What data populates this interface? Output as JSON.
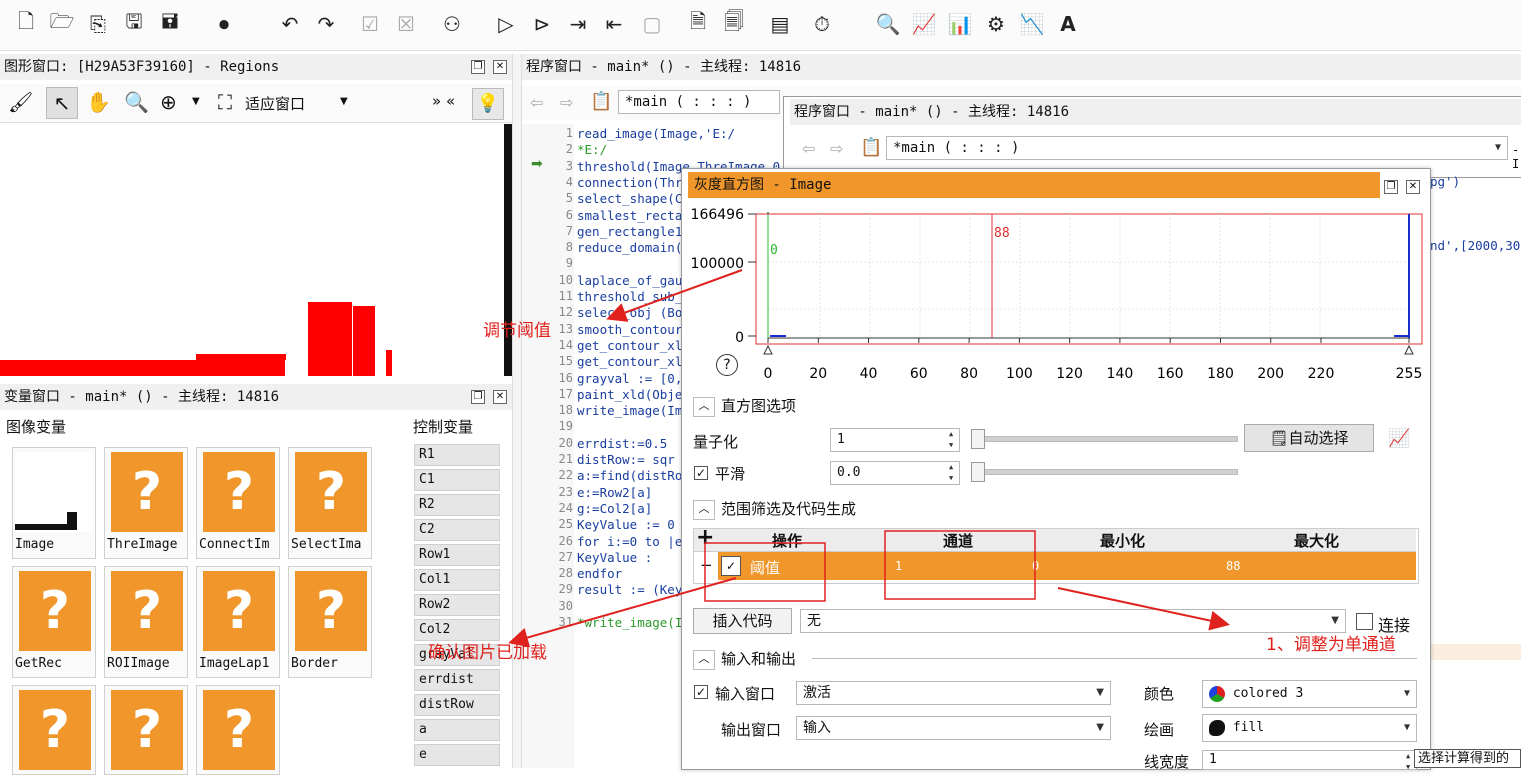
{
  "toolbar": {
    "icons": [
      "new-file-icon",
      "open-file-icon",
      "export-icon",
      "save-icon",
      "save-all-icon",
      "record-icon",
      "undo-icon",
      "redo-icon",
      "activate-icon",
      "deactivate-icon",
      "binoculars-icon",
      "run-icon",
      "step-icon",
      "step-over-icon",
      "step-back-icon",
      "stop-icon",
      "insert-code-icon",
      "program-icon",
      "profiler-icon",
      "timer-icon",
      "zoom-icon",
      "histogram-icon",
      "line-profile-icon",
      "gray-icon",
      "feature-icon",
      "ocr-icon"
    ]
  },
  "graphics_window": {
    "title": "图形窗口: [H29A53F39160] - Regions",
    "fit_label": "适应窗口",
    "arrows": "» «"
  },
  "variable_window": {
    "title": "变量窗口 - main* () - 主线程: 14816",
    "image_vars_title": "图像变量",
    "control_vars_title": "控制变量",
    "image_vars": [
      "Image",
      "ThreImage",
      "ConnectIm",
      "SelectIma",
      "GetRec",
      "ROIImage",
      "ImageLap1",
      "Border",
      "",
      "",
      ""
    ],
    "control_vars": [
      "R1",
      "C1",
      "R2",
      "C2",
      "Row1",
      "Col1",
      "Row2",
      "Col2",
      "grayVal",
      "errdist",
      "distRow",
      "a",
      "e"
    ]
  },
  "program_window_back": {
    "title": "程序窗口 - main* () - 主线程: 14816",
    "proc_label": "*main ( : : : )"
  },
  "program_window_front": {
    "title": "程序窗口 - main* () - 主线程: 14816",
    "proc_label": "*main ( : : : )",
    "side_text_1": "pg')",
    "side_text_2": "nd',[2000,30",
    "side_text_3": "-I"
  },
  "code": {
    "lines": [
      {
        "n": "1",
        "t": "read_image(Image,'E:/"
      },
      {
        "n": "2",
        "t": "*E:/"
      },
      {
        "n": "3",
        "t": "threshold(Image,ThreImage,0"
      },
      {
        "n": "4",
        "t": "connection(Thr"
      },
      {
        "n": "5",
        "t": "select_shape(C"
      },
      {
        "n": "6",
        "t": "smallest_recta"
      },
      {
        "n": "7",
        "t": "gen_rectangle1"
      },
      {
        "n": "8",
        "t": "reduce_domain("
      },
      {
        "n": "9",
        "t": ""
      },
      {
        "n": "10",
        "t": "laplace_of_gau"
      },
      {
        "n": "11",
        "t": "threshold_sub_"
      },
      {
        "n": "12",
        "t": "select_obj (Bo"
      },
      {
        "n": "13",
        "t": "smooth_contour"
      },
      {
        "n": "14",
        "t": "get_contour_xl"
      },
      {
        "n": "15",
        "t": "get_contour_xl"
      },
      {
        "n": "16",
        "t": "grayval := [0,"
      },
      {
        "n": "17",
        "t": "paint_xld(Obje"
      },
      {
        "n": "18",
        "t": "write_image(Im"
      },
      {
        "n": "19",
        "t": ""
      },
      {
        "n": "20",
        "t": "errdist:=0.5"
      },
      {
        "n": "21",
        "t": "distRow:=  sqr"
      },
      {
        "n": "22",
        "t": "a:=find(distRo"
      },
      {
        "n": "23",
        "t": "e:=Row2[a]"
      },
      {
        "n": "24",
        "t": "g:=Col2[a]"
      },
      {
        "n": "25",
        "t": "KeyValue := 0"
      },
      {
        "n": "26",
        "t": "for i:=0 to |e"
      },
      {
        "n": "27",
        "t": "    KeyValue :"
      },
      {
        "n": "28",
        "t": "endfor"
      },
      {
        "n": "29",
        "t": "result := (Key"
      },
      {
        "n": "30",
        "t": ""
      },
      {
        "n": "31",
        "t": "*write_image(I"
      }
    ]
  },
  "histogram": {
    "title": "灰度直方图 - Image",
    "y_ticks": [
      "166496",
      "100000",
      "0"
    ],
    "x_ticks": [
      "0",
      "20",
      "40",
      "60",
      "80",
      "100",
      "120",
      "140",
      "160",
      "180",
      "200",
      "220",
      "255"
    ],
    "min_label": "0",
    "max_label": "88",
    "help": "?",
    "options_section": "直方图选项",
    "quantize_label": "量子化",
    "quantize_value": "1",
    "auto_select": "自动选择",
    "smooth_label": "平滑",
    "smooth_value": "0.0",
    "range_section": "范围筛选及代码生成",
    "table": {
      "add": "+",
      "headers": [
        "操作",
        "通道",
        "最小化",
        "最大化"
      ],
      "row": {
        "minus": "−",
        "op": "阈值",
        "channel": "1",
        "min": "0",
        "max": "88"
      }
    },
    "insert_code_btn": "插入代码",
    "insert_code_value": "无",
    "connect_label": "连接",
    "io_section": "输入和输出",
    "input_window_label": "输入窗口",
    "input_window_value": "激活",
    "output_window_label": "输出窗口",
    "output_window_value": "输入",
    "color_label": "颜色",
    "color_value": "colored 3",
    "draw_label": "绘画",
    "draw_value": "fill",
    "line_width_label": "线宽度",
    "line_width_value": "1",
    "tooltip": "选择计算得到的"
  },
  "annotations": {
    "threshold": "调节阈值",
    "image_loaded": "确认图片已加载",
    "single_channel": "1、调整为单通道"
  },
  "colors": {
    "accent": "#f0962a",
    "annotation": "#e0221e"
  }
}
